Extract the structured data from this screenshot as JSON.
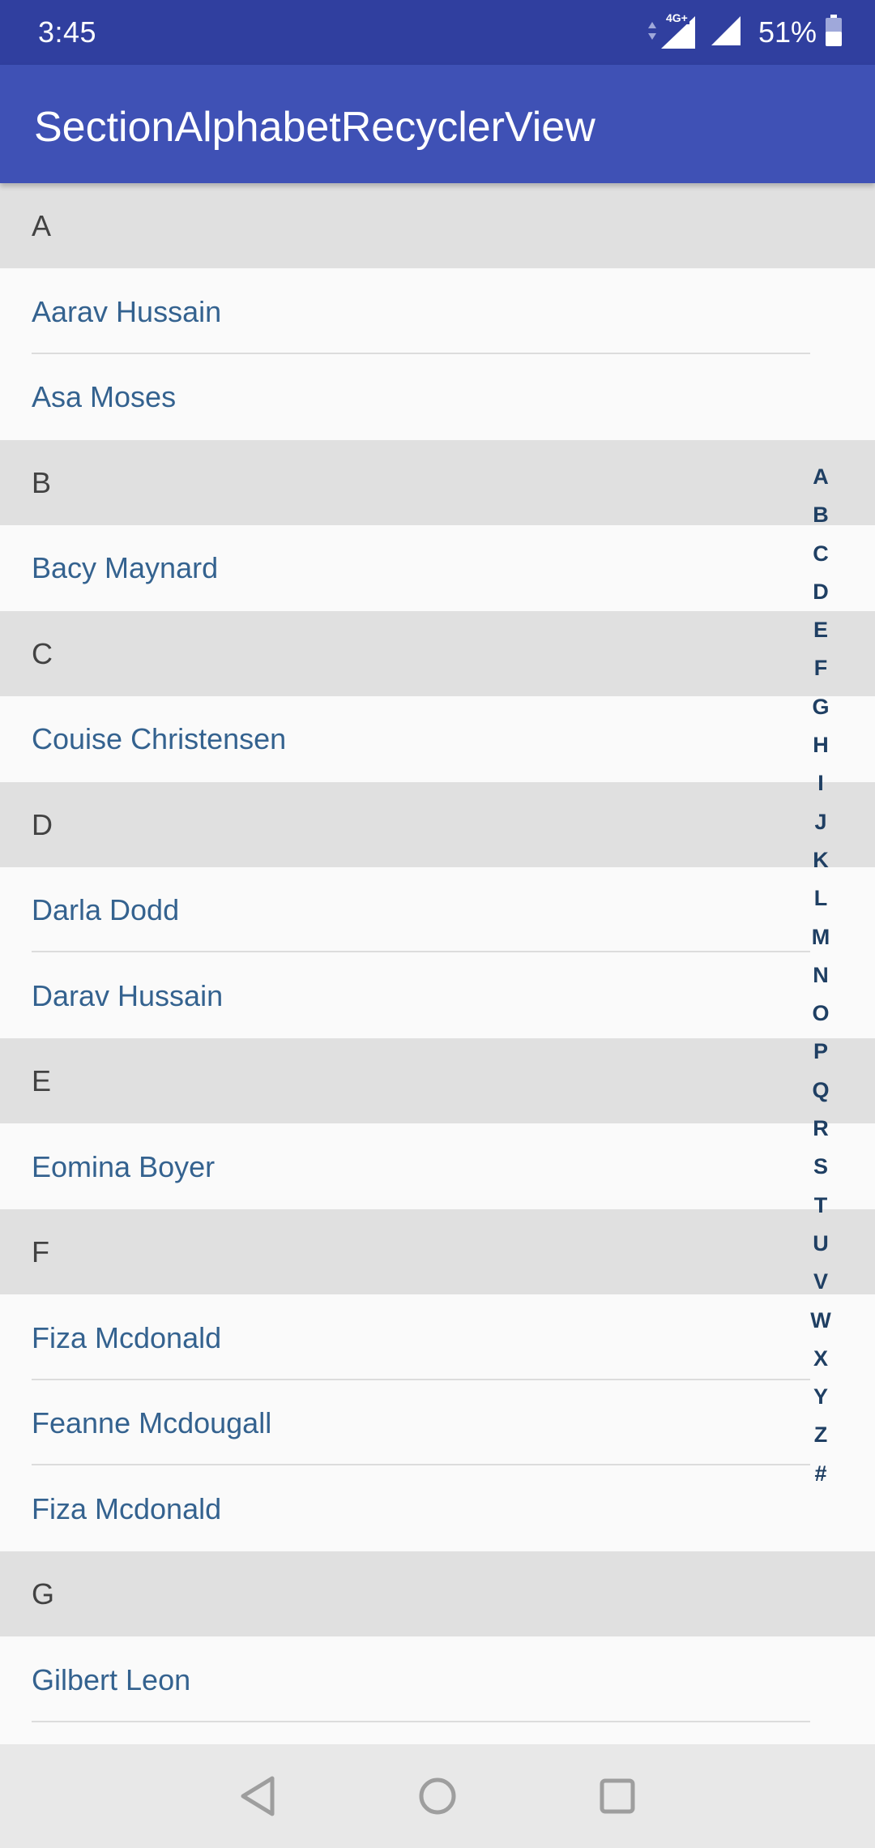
{
  "status_bar": {
    "time": "3:45",
    "network_label": "4G+",
    "battery_percent": "51%",
    "background": "#303f9f"
  },
  "toolbar": {
    "title": "SectionAlphabetRecyclerView",
    "background": "#3f51b5"
  },
  "list": {
    "rows": [
      {
        "kind": "header",
        "text": "A"
      },
      {
        "kind": "item",
        "text": "Aarav Hussain"
      },
      {
        "kind": "item",
        "text": "Asa Moses"
      },
      {
        "kind": "header",
        "text": "B"
      },
      {
        "kind": "item",
        "text": "Bacy Maynard"
      },
      {
        "kind": "header",
        "text": "C"
      },
      {
        "kind": "item",
        "text": "Couise Christensen"
      },
      {
        "kind": "header",
        "text": "D"
      },
      {
        "kind": "item",
        "text": "Darla Dodd"
      },
      {
        "kind": "item",
        "text": "Darav Hussain"
      },
      {
        "kind": "header",
        "text": "E"
      },
      {
        "kind": "item",
        "text": "Eomina Boyer"
      },
      {
        "kind": "header",
        "text": "F"
      },
      {
        "kind": "item",
        "text": "Fiza Mcdonald"
      },
      {
        "kind": "item",
        "text": "Feanne Mcdougall"
      },
      {
        "kind": "item",
        "text": "Fiza Mcdonald"
      },
      {
        "kind": "header",
        "text": "G"
      },
      {
        "kind": "item",
        "text": "Gilbert Leon"
      }
    ],
    "header_color": "#e0e0e0",
    "item_text_color": "#34628f"
  },
  "side_index": {
    "letters": [
      "A",
      "B",
      "C",
      "D",
      "E",
      "F",
      "G",
      "H",
      "I",
      "J",
      "K",
      "L",
      "M",
      "N",
      "O",
      "P",
      "Q",
      "R",
      "S",
      "T",
      "U",
      "V",
      "W",
      "X",
      "Y",
      "Z",
      "#"
    ],
    "color": "#1f3f63"
  },
  "nav_bar": {
    "buttons": [
      "back-icon",
      "home-icon",
      "recents-icon"
    ]
  }
}
